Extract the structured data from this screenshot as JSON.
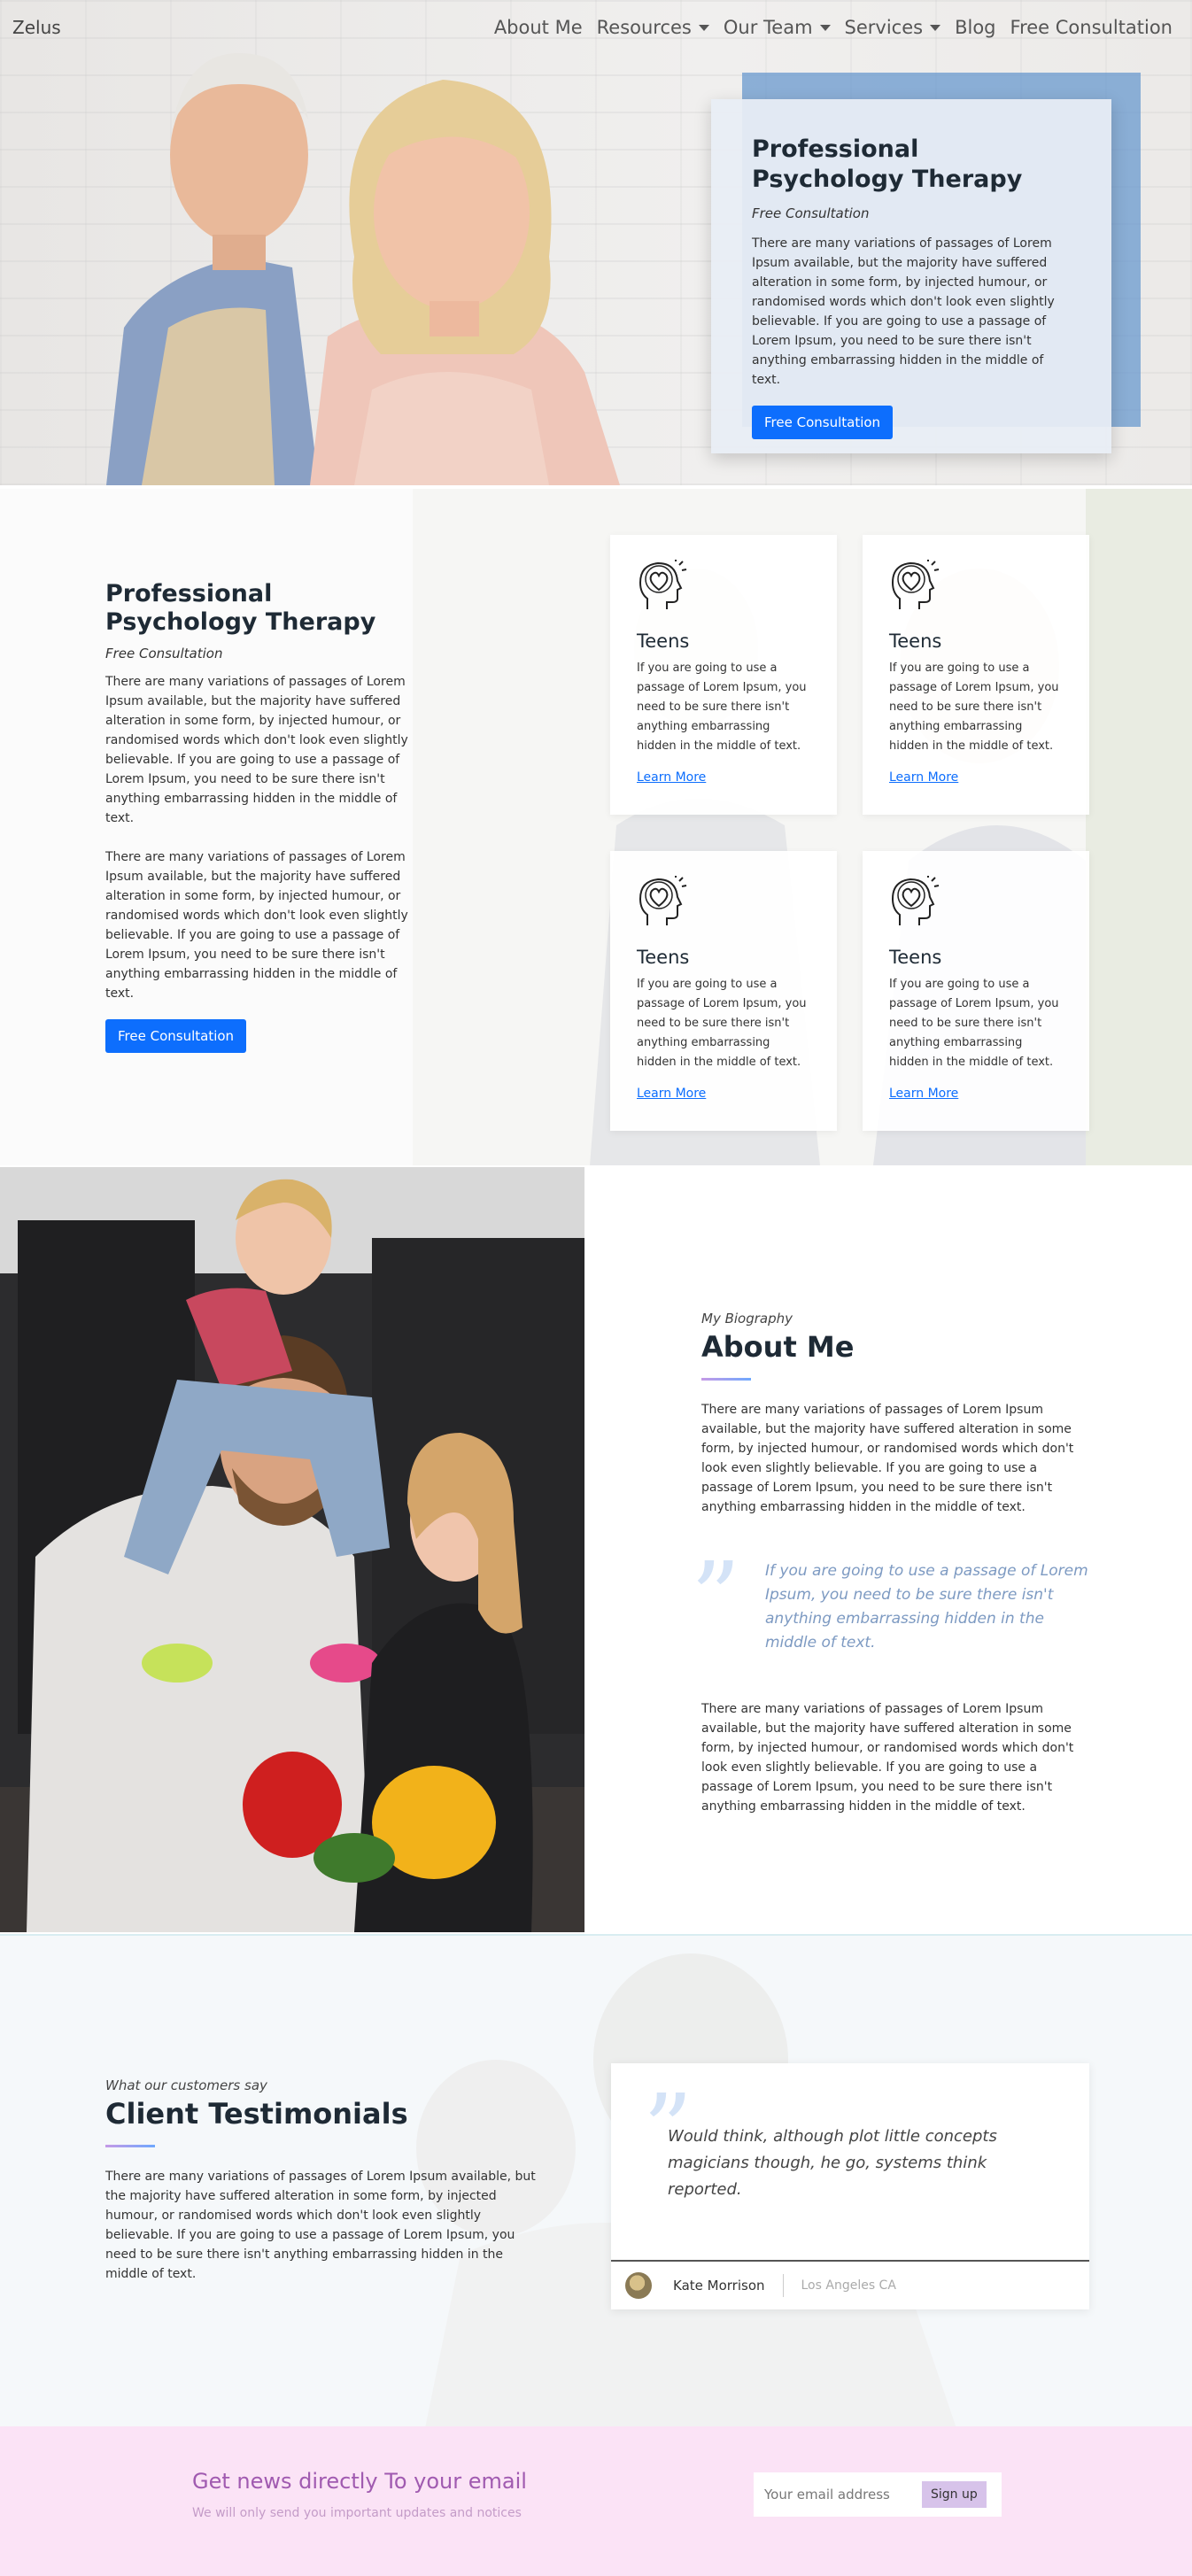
{
  "nav": {
    "brand": "Zelus",
    "items": [
      {
        "label": "About Me",
        "dropdown": false
      },
      {
        "label": "Resources",
        "dropdown": true
      },
      {
        "label": "Our Team",
        "dropdown": true
      },
      {
        "label": "Services",
        "dropdown": true
      },
      {
        "label": "Blog",
        "dropdown": false
      },
      {
        "label": "Free Consultation",
        "dropdown": false
      }
    ]
  },
  "hero": {
    "title": "Professional Psychology Therapy",
    "subtitle": "Free Consultation",
    "body": "There are many variations of passages of Lorem Ipsum available, but the majority have suffered alteration in some form, by injected humour, or randomised words which don't look even slightly believable. If you are going to use a passage of Lorem Ipsum, you need to be sure there isn't anything embarrassing hidden in the middle of text.",
    "button": "Free Consultation"
  },
  "intro": {
    "title": "Professional Psychology Therapy",
    "subtitle": "Free Consultation",
    "paragraph1": "There are many variations of passages of Lorem Ipsum available, but the majority have suffered alteration in some form, by injected humour, or randomised words which don't look even slightly believable. If you are going to use a passage of Lorem Ipsum, you need to be sure there isn't anything embarrassing hidden in the middle of text.",
    "paragraph2": "There are many variations of passages of Lorem Ipsum available, but the majority have suffered alteration in some form, by injected humour, or randomised words which don't look even slightly believable. If you are going to use a passage of Lorem Ipsum, you need to be sure there isn't anything embarrassing hidden in the middle of text.",
    "button": "Free Consultation"
  },
  "services": [
    {
      "icon": "head-heart-icon",
      "title": "Teens",
      "body": "If you are going to use a passage of Lorem Ipsum, you need to be sure there isn't anything embarrassing hidden in the middle of text.",
      "link": "Learn More"
    },
    {
      "icon": "head-heart-icon",
      "title": "Teens",
      "body": "If you are going to use a passage of Lorem Ipsum, you need to be sure there isn't anything embarrassing hidden in the middle of text.",
      "link": "Learn More"
    },
    {
      "icon": "head-heart-icon",
      "title": "Teens",
      "body": "If you are going to use a passage of Lorem Ipsum, you need to be sure there isn't anything embarrassing hidden in the middle of text.",
      "link": "Learn More"
    },
    {
      "icon": "head-heart-icon",
      "title": "Teens",
      "body": "If you are going to use a passage of Lorem Ipsum, you need to be sure there isn't anything embarrassing hidden in the middle of text.",
      "link": "Learn More"
    }
  ],
  "about": {
    "kicker": "My Biography",
    "title": "About Me",
    "paragraph1": "There are many variations of passages of Lorem Ipsum available, but the majority have suffered alteration in some form, by injected humour, or randomised words which don't look even slightly believable. If you are going to use a passage of Lorem Ipsum, you need to be sure there isn't anything embarrassing hidden in the middle of text.",
    "quote": "If you are going to use a passage of Lorem Ipsum, you need to be sure there isn't anything embarrassing hidden in the middle of text.",
    "paragraph2": "There are many variations of passages of Lorem Ipsum available, but the majority have suffered alteration in some form, by injected humour, or randomised words which don't look even slightly believable. If you are going to use a passage of Lorem Ipsum, you need to be sure there isn't anything embarrassing hidden in the middle of text."
  },
  "testimonials": {
    "kicker": "What our customers say",
    "title": "Client Testimonials",
    "body": "There are many variations of passages of Lorem Ipsum available, but the majority have suffered alteration in some form, by injected humour, or randomised words which don't look even slightly believable. If you are going to use a passage of Lorem Ipsum, you need to be sure there isn't anything embarrassing hidden in the middle of text.",
    "quote": "Would think, although plot little concepts magicians though, he go, systems think reported.",
    "name": "Kate Morrison",
    "location": "Los Angeles CA"
  },
  "newsletter": {
    "title": "Get news directly To your email",
    "subtitle": "We will only send you important updates and notices",
    "placeholder": "Your email address",
    "button": "Sign up"
  },
  "colors": {
    "primary": "#0d6efd",
    "hero_overlay": "#6496cd",
    "newsletter_bg": "#fbe3f6",
    "newsletter_title": "#a05ab0",
    "quote": "#7d9ac2"
  }
}
